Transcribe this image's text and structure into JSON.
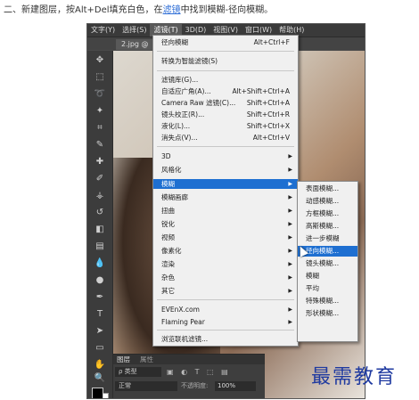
{
  "caption": {
    "prefix": "二、新建图层，按Alt+Del填充白色，在",
    "link": "滤镜",
    "suffix": "中找到模糊-径向模糊。"
  },
  "menubar": [
    "文字(Y)",
    "选择(S)",
    "滤镜(T)",
    "3D(D)",
    "视图(V)",
    "窗口(W)",
    "帮助(H)"
  ],
  "document_tab": "2.jpg @",
  "filter_menu": {
    "items": [
      {
        "label": "径向模糊",
        "shortcut": "Alt+Ctrl+F"
      },
      {
        "label": "转换为智能滤镜(S)",
        "shortcut": ""
      },
      {
        "label": "滤镜库(G)...",
        "shortcut": ""
      },
      {
        "label": "自适应广角(A)...",
        "shortcut": "Alt+Shift+Ctrl+A"
      },
      {
        "label": "Camera Raw 滤镜(C)...",
        "shortcut": "Shift+Ctrl+A"
      },
      {
        "label": "镜头校正(R)...",
        "shortcut": "Shift+Ctrl+R"
      },
      {
        "label": "液化(L)...",
        "shortcut": "Shift+Ctrl+X"
      },
      {
        "label": "消失点(V)...",
        "shortcut": "Alt+Ctrl+V"
      },
      {
        "label": "3D",
        "shortcut": ""
      },
      {
        "label": "风格化",
        "shortcut": ""
      },
      {
        "label": "模糊",
        "shortcut": ""
      },
      {
        "label": "模糊画廊",
        "shortcut": ""
      },
      {
        "label": "扭曲",
        "shortcut": ""
      },
      {
        "label": "锐化",
        "shortcut": ""
      },
      {
        "label": "视频",
        "shortcut": ""
      },
      {
        "label": "像素化",
        "shortcut": ""
      },
      {
        "label": "渲染",
        "shortcut": ""
      },
      {
        "label": "杂色",
        "shortcut": ""
      },
      {
        "label": "其它",
        "shortcut": ""
      },
      {
        "label": "EVEnX.com",
        "shortcut": ""
      },
      {
        "label": "Flaming Pear",
        "shortcut": ""
      },
      {
        "label": "浏览联机滤镜...",
        "shortcut": ""
      }
    ]
  },
  "blur_submenu": [
    "表面模糊...",
    "动感模糊...",
    "方框模糊...",
    "高斯模糊...",
    "进一步模糊",
    "径向模糊...",
    "镜头模糊...",
    "模糊",
    "平均",
    "特殊模糊...",
    "形状模糊..."
  ],
  "layers_panel": {
    "tabs": [
      "图层",
      "属性"
    ],
    "kind": "ρ 类型",
    "blend_mode": "正常",
    "opacity_label": "不透明度:",
    "opacity_value": "100%"
  },
  "watermark": "最需教育",
  "colors": {
    "highlight": "#1e6fd1",
    "link": "#2a6bd6",
    "watermark": "#1f3aa0"
  }
}
